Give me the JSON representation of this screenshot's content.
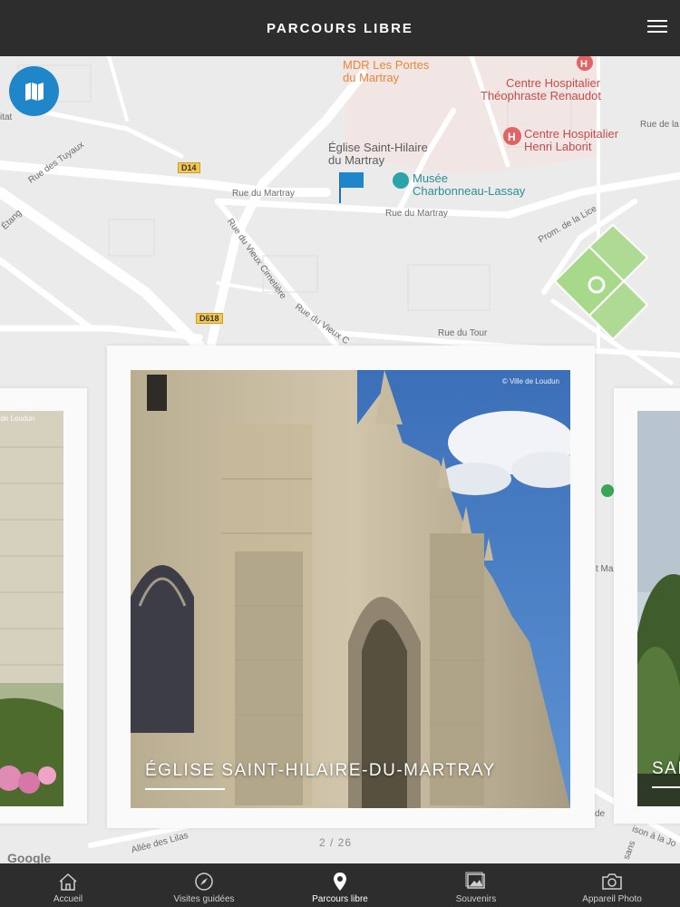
{
  "header": {
    "title": "PARCOURS LIBRE",
    "menu_icon": "hamburger-menu-icon"
  },
  "map": {
    "fab_icon": "map-book-icon",
    "fab_color": "#1f86c9",
    "labels": {
      "mdr_line1": "MDR Les Portes",
      "mdr_line2": "du Martray",
      "hosp1_line1": "Centre Hospitalier",
      "hosp1_line2": "Théophraste Renaudot",
      "hosp2_line1": "Centre Hospitalier",
      "hosp2_line2": "Henri Laborit",
      "eglise_line1": "Église Saint-Hilaire",
      "eglise_line2": "du Martray",
      "musee_line1": "Musée",
      "musee_line2": "Charbonneau-Lassay",
      "rue_tuyaux": "Rue des Tuyaux",
      "rue_martray_1": "Rue du Martray",
      "rue_martray_2": "Rue du Martray",
      "rue_vieux_cim": "Rue du Vieux Cimetière",
      "rue_vieux_c2": "Rue du Vieux C",
      "rue_tour": "Rue du Tour",
      "prom_lice": "Prom. de la Lice",
      "rue_de_la": "Rue de la",
      "etang": "Étang",
      "itat": "itat",
      "allee_lilas": "Allée des Lilas",
      "t_ma": "t Ma",
      "de": "de",
      "ison_a_la_jo": "ison à la Jo",
      "sans": "sans",
      "d14": "D14",
      "d618": "D618"
    }
  },
  "cards": {
    "left": {
      "credit": "le de Loudun"
    },
    "main": {
      "credit": "© Ville de Loudun",
      "title": "ÉGLISE SAINT-HILAIRE-DU-MARTRAY"
    },
    "right": {
      "title": "SAI"
    }
  },
  "pager": "2 / 26",
  "google": "Google",
  "bottom_nav": {
    "items": [
      {
        "label": "Accueil",
        "icon": "home-icon"
      },
      {
        "label": "Visites guidées",
        "icon": "compass-icon"
      },
      {
        "label": "Parcours libre",
        "icon": "map-pin-icon",
        "active": true
      },
      {
        "label": "Souvenirs",
        "icon": "photos-icon"
      },
      {
        "label": "Appareil Photo",
        "icon": "camera-icon"
      }
    ]
  }
}
